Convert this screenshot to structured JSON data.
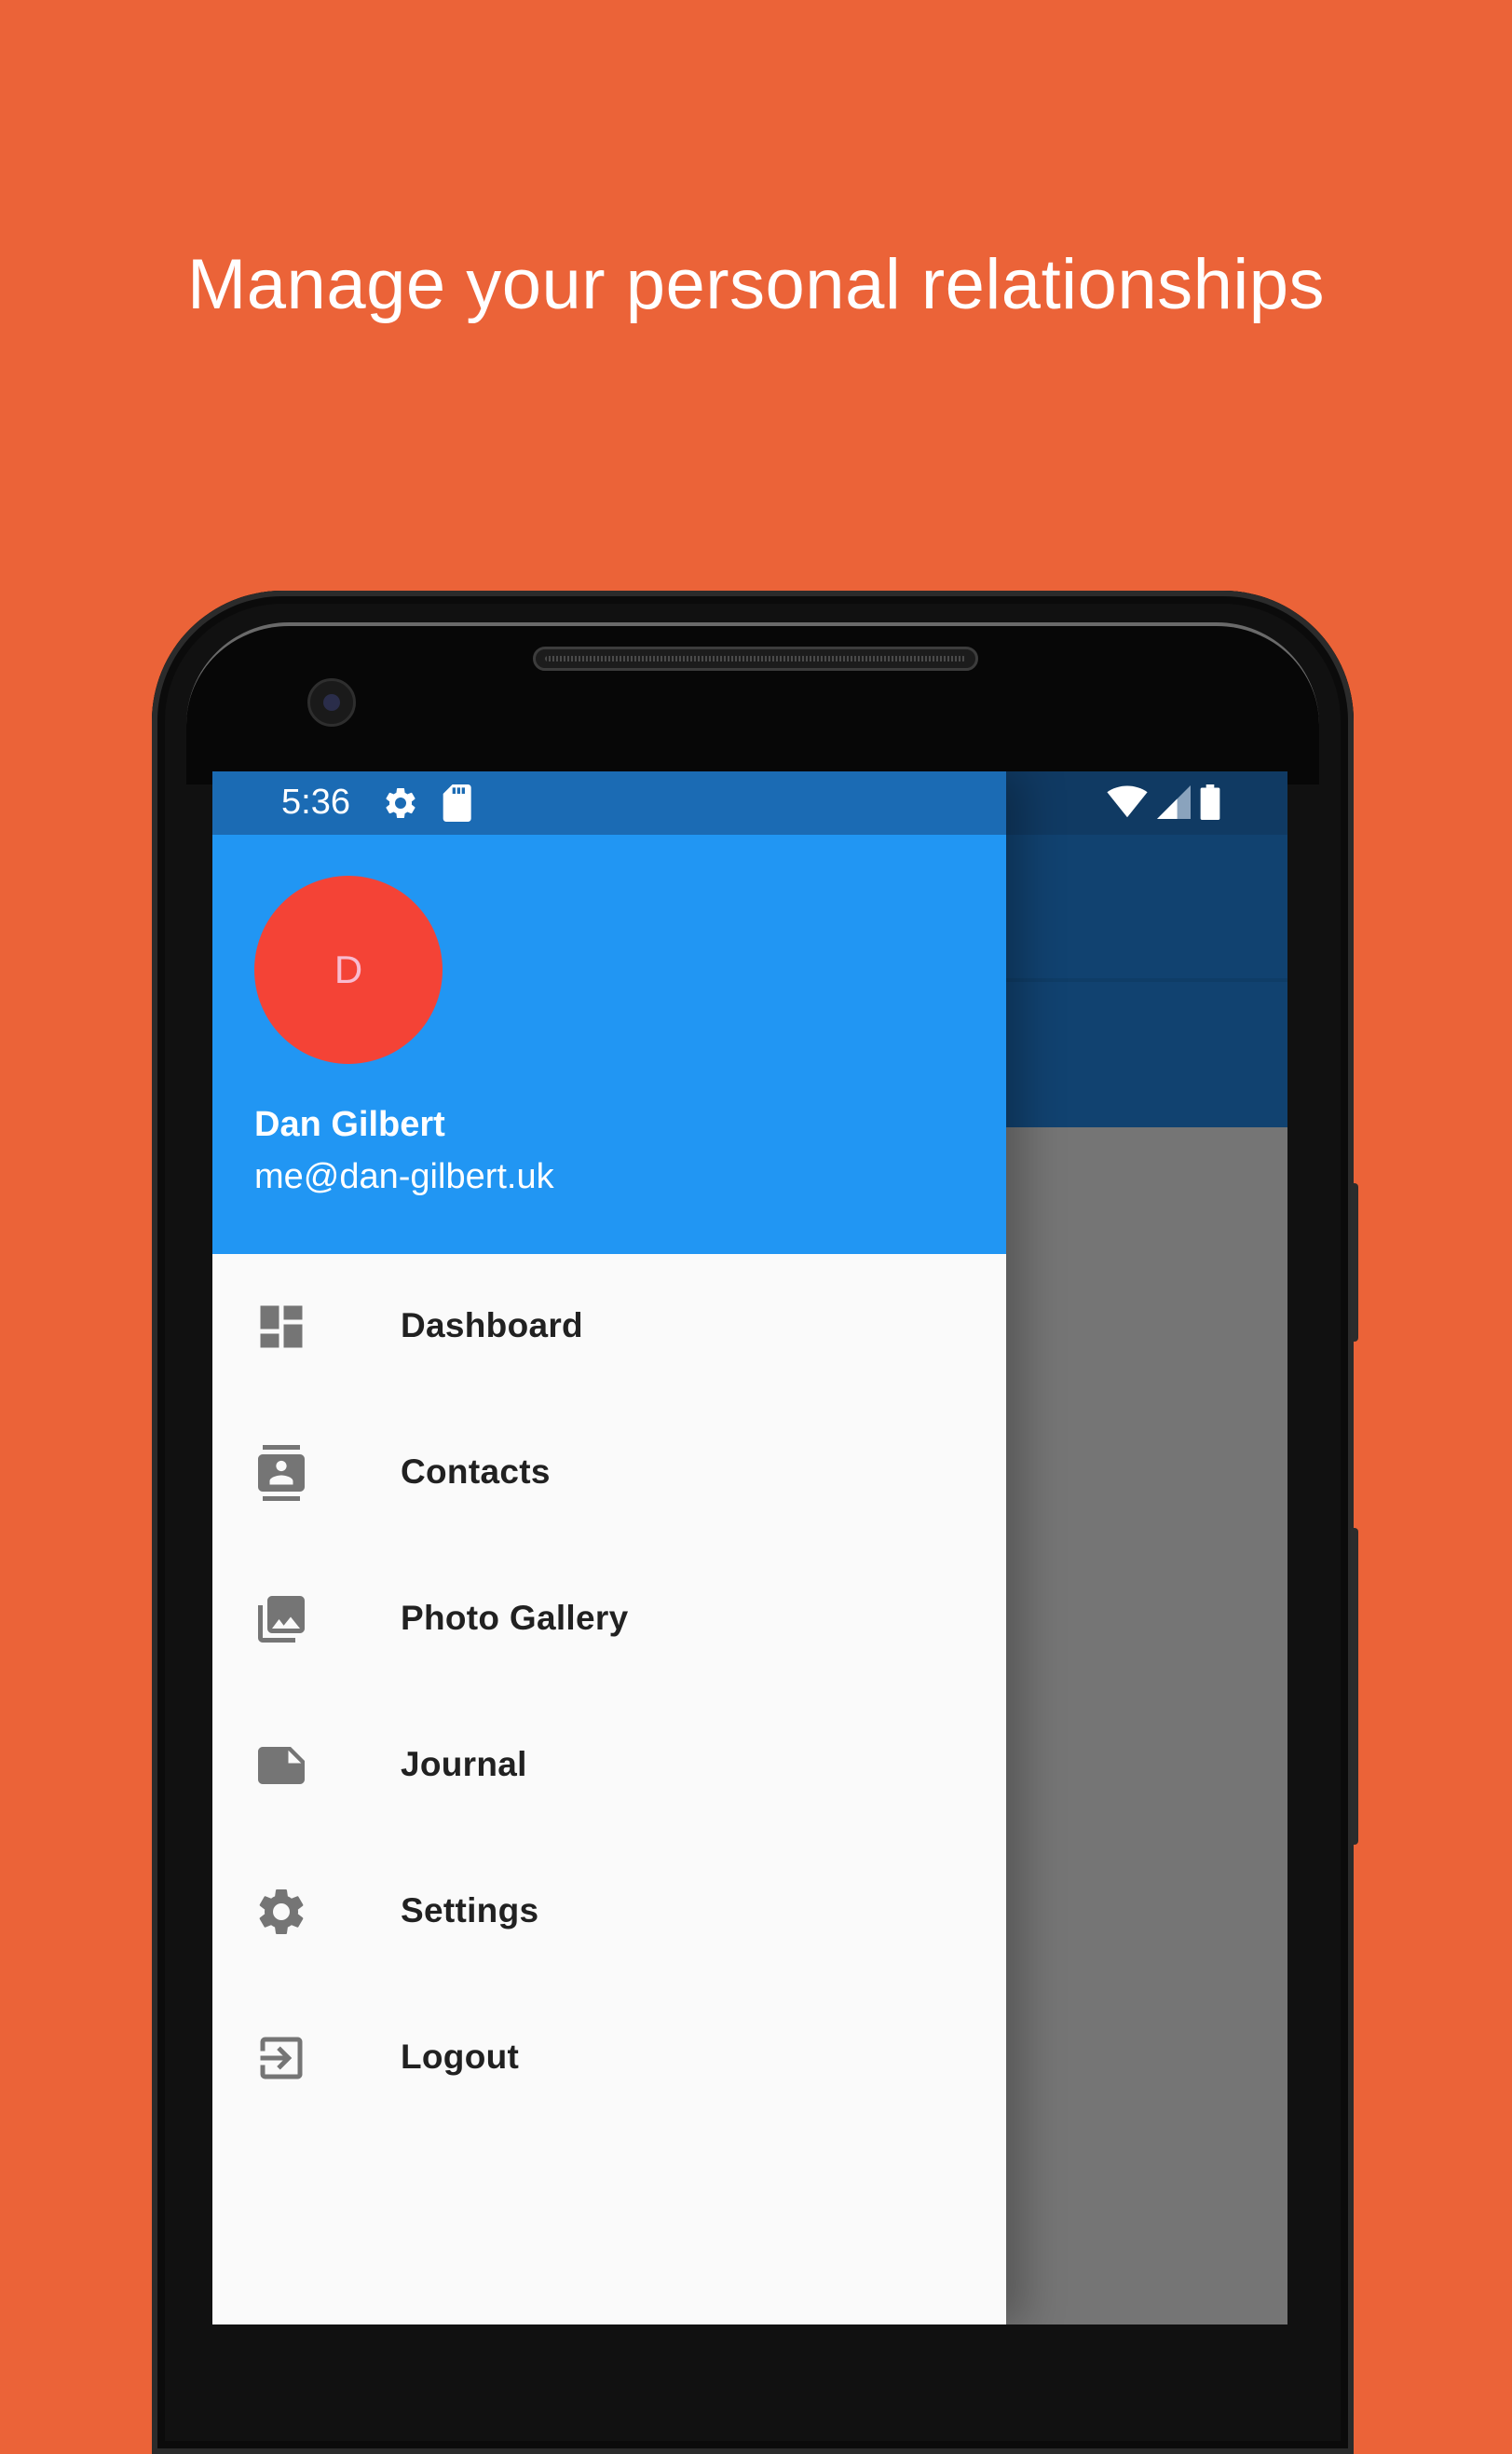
{
  "headline": "Manage your personal relationships",
  "status_bar": {
    "time": "5:36",
    "left_icons": [
      "gear-icon",
      "sd-card-icon"
    ],
    "right_icons": [
      "wifi-icon",
      "signal-icon",
      "battery-icon"
    ]
  },
  "drawer": {
    "avatar_initial": "D",
    "user_name": "Dan Gilbert",
    "user_email": "me@dan-gilbert.uk",
    "items": [
      {
        "label": "Dashboard",
        "icon": "dashboard-icon"
      },
      {
        "label": "Contacts",
        "icon": "contacts-icon"
      },
      {
        "label": "Photo Gallery",
        "icon": "photo-gallery-icon"
      },
      {
        "label": "Journal",
        "icon": "journal-icon"
      },
      {
        "label": "Settings",
        "icon": "settings-icon"
      },
      {
        "label": "Logout",
        "icon": "logout-icon"
      }
    ]
  },
  "colors": {
    "background": "#EB6338",
    "drawer_header": "#2196F3",
    "status_bar": "#1B6BB4",
    "avatar": "#F44336",
    "app_bar_behind": "#114270",
    "icon_gray": "#757575"
  }
}
